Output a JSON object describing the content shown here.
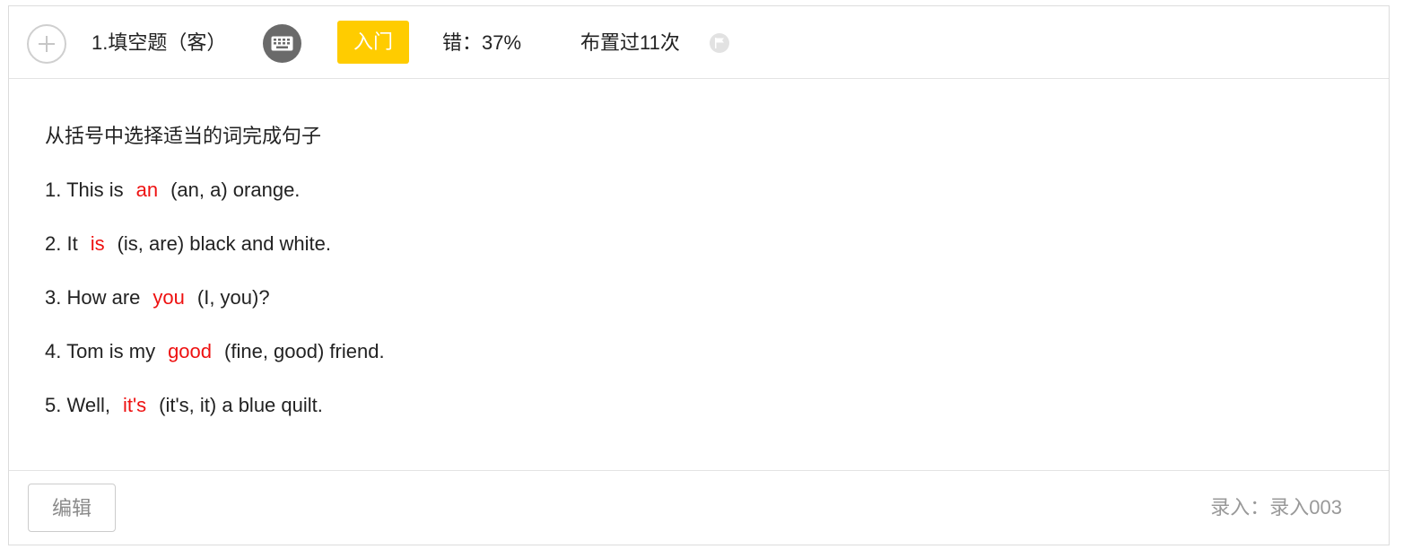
{
  "header": {
    "question_title": "1.填空题（客）",
    "keyboard_icon": "keyboard-icon",
    "level_badge": "入门",
    "level_color": "#ffcc00",
    "error_rate": "错：37%",
    "assigned_count": "布置过11次",
    "flag_icon": "flag-icon"
  },
  "question": {
    "instruction": "从括号中选择适当的词完成句子",
    "answer_color": "#ee1111",
    "items": [
      {
        "before": "1. This is",
        "answer": "an",
        "after": "(an, a) orange."
      },
      {
        "before": "2. It",
        "answer": "is",
        "after": "(is, are) black and white."
      },
      {
        "before": "3. How are",
        "answer": "you",
        "after": "(I, you)?"
      },
      {
        "before": "4. Tom is my",
        "answer": "good",
        "after": "(fine, good) friend."
      },
      {
        "before": "5. Well,",
        "answer": "it's",
        "after": "(it's, it) a blue quilt."
      }
    ]
  },
  "footer": {
    "edit_label": "编辑",
    "entry_info": "录入：录入003"
  }
}
